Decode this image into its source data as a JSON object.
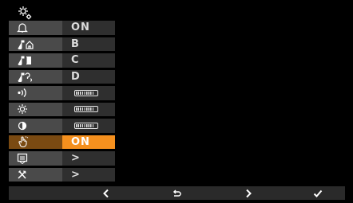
{
  "menu": {
    "rows": [
      {
        "icon": "bell-icon",
        "value": "ON"
      },
      {
        "icon": "melody-door-icon",
        "value": "B"
      },
      {
        "icon": "melody-floor-icon",
        "value": "C"
      },
      {
        "icon": "melody-intercom-icon",
        "value": "D"
      },
      {
        "icon": "volume-icon",
        "level": 0.8
      },
      {
        "icon": "brightness-icon",
        "level": 0.8
      },
      {
        "icon": "contrast-icon",
        "level": 0.8
      },
      {
        "icon": "touch-hand-icon",
        "value": "ON",
        "active": true
      },
      {
        "icon": "screen-clean-icon",
        "value": ">"
      },
      {
        "icon": "tools-icon",
        "value": ">"
      }
    ]
  },
  "bottombar": {
    "buttons": [
      {
        "name": "back-button",
        "icon": "chevron-left-icon"
      },
      {
        "name": "return-button",
        "icon": "return-arrow-icon"
      },
      {
        "name": "forward-button",
        "icon": "chevron-right-icon"
      },
      {
        "name": "confirm-button",
        "icon": "checkmark-icon"
      }
    ]
  },
  "colors": {
    "active": "#f5901e",
    "icon_column": "#4a4a4a",
    "value_column": "#2f2f2f"
  }
}
